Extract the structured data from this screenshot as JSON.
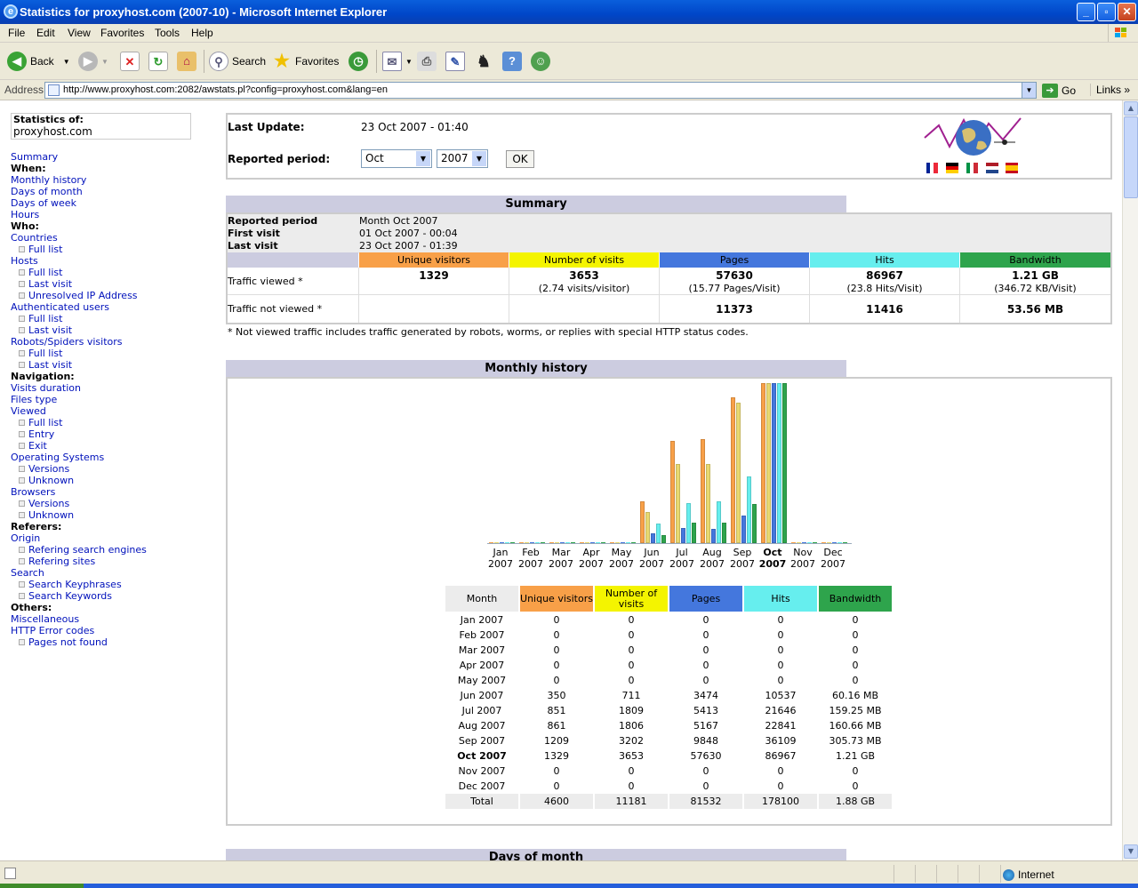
{
  "window": {
    "title": "Statistics for proxyhost.com (2007-10) - Microsoft Internet Explorer",
    "min": "_",
    "max": "▫",
    "close": "✕"
  },
  "menubar": [
    "File",
    "Edit",
    "View",
    "Favorites",
    "Tools",
    "Help"
  ],
  "toolbar": {
    "back": "Back",
    "search": "Search",
    "favorites": "Favorites"
  },
  "address": {
    "label": "Address",
    "url": "http://www.proxyhost.com:2082/awstats.pl?config=proxyhost.com&lang=en",
    "go": "Go",
    "links": "Links"
  },
  "status": {
    "zone": "Internet"
  },
  "sidebar": {
    "stats_of": "Statistics of:",
    "host": "proxyhost.com",
    "items": [
      {
        "t": "Summary",
        "k": "link",
        "lvl": 0
      },
      {
        "t": "When:",
        "k": "head",
        "lvl": 0
      },
      {
        "t": "Monthly history",
        "k": "link",
        "lvl": 0
      },
      {
        "t": "Days of month",
        "k": "link",
        "lvl": 0
      },
      {
        "t": "Days of week",
        "k": "link",
        "lvl": 0
      },
      {
        "t": "Hours",
        "k": "link",
        "lvl": 0
      },
      {
        "t": "Who:",
        "k": "head",
        "lvl": 0
      },
      {
        "t": "Countries",
        "k": "link",
        "lvl": 0
      },
      {
        "t": "Full list",
        "k": "link",
        "lvl": 1
      },
      {
        "t": "Hosts",
        "k": "link",
        "lvl": 0
      },
      {
        "t": "Full list",
        "k": "link",
        "lvl": 1
      },
      {
        "t": "Last visit",
        "k": "link",
        "lvl": 1
      },
      {
        "t": "Unresolved IP Address",
        "k": "link",
        "lvl": 1
      },
      {
        "t": "Authenticated users",
        "k": "link",
        "lvl": 0
      },
      {
        "t": "Full list",
        "k": "link",
        "lvl": 1
      },
      {
        "t": "Last visit",
        "k": "link",
        "lvl": 1
      },
      {
        "t": "Robots/Spiders visitors",
        "k": "link",
        "lvl": 0
      },
      {
        "t": "Full list",
        "k": "link",
        "lvl": 1
      },
      {
        "t": "Last visit",
        "k": "link",
        "lvl": 1
      },
      {
        "t": "Navigation:",
        "k": "head",
        "lvl": 0
      },
      {
        "t": "Visits duration",
        "k": "link",
        "lvl": 0
      },
      {
        "t": "Files type",
        "k": "link",
        "lvl": 0
      },
      {
        "t": "Viewed",
        "k": "link",
        "lvl": 0
      },
      {
        "t": "Full list",
        "k": "link",
        "lvl": 1
      },
      {
        "t": "Entry",
        "k": "link",
        "lvl": 1
      },
      {
        "t": "Exit",
        "k": "link",
        "lvl": 1
      },
      {
        "t": "Operating Systems",
        "k": "link",
        "lvl": 0
      },
      {
        "t": "Versions",
        "k": "link",
        "lvl": 1
      },
      {
        "t": "Unknown",
        "k": "link",
        "lvl": 1
      },
      {
        "t": "Browsers",
        "k": "link",
        "lvl": 0
      },
      {
        "t": "Versions",
        "k": "link",
        "lvl": 1
      },
      {
        "t": "Unknown",
        "k": "link",
        "lvl": 1
      },
      {
        "t": "Referers:",
        "k": "head",
        "lvl": 0
      },
      {
        "t": "Origin",
        "k": "link",
        "lvl": 0
      },
      {
        "t": "Refering search engines",
        "k": "link",
        "lvl": 1
      },
      {
        "t": "Refering sites",
        "k": "link",
        "lvl": 1
      },
      {
        "t": "Search",
        "k": "link",
        "lvl": 0
      },
      {
        "t": "Search Keyphrases",
        "k": "link",
        "lvl": 1
      },
      {
        "t": "Search Keywords",
        "k": "link",
        "lvl": 1
      },
      {
        "t": "Others:",
        "k": "head",
        "lvl": 0
      },
      {
        "t": "Miscellaneous",
        "k": "link",
        "lvl": 0
      },
      {
        "t": "HTTP Error codes",
        "k": "link",
        "lvl": 0
      },
      {
        "t": "Pages not found",
        "k": "link",
        "lvl": 1
      }
    ]
  },
  "header": {
    "last_update_label": "Last Update:",
    "last_update": "23 Oct 2007 - 01:40",
    "period_label": "Reported period:",
    "month": "Oct",
    "year": "2007",
    "ok": "OK"
  },
  "summary": {
    "title": "Summary",
    "reported_period_label": "Reported period",
    "reported_period": "Month Oct 2007",
    "first_visit_label": "First visit",
    "first_visit": "01 Oct 2007 - 00:04",
    "last_visit_label": "Last visit",
    "last_visit": "23 Oct 2007 - 01:39",
    "cols": [
      "Unique visitors",
      "Number of visits",
      "Pages",
      "Hits",
      "Bandwidth"
    ],
    "viewed_label": "Traffic viewed *",
    "viewed": [
      {
        "v": "1329",
        "s": ""
      },
      {
        "v": "3653",
        "s": "(2.74 visits/visitor)"
      },
      {
        "v": "57630",
        "s": "(15.77 Pages/Visit)"
      },
      {
        "v": "86967",
        "s": "(23.8 Hits/Visit)"
      },
      {
        "v": "1.21 GB",
        "s": "(346.72 KB/Visit)"
      }
    ],
    "notviewed_label": "Traffic not viewed *",
    "notviewed": [
      "",
      "",
      "11373",
      "11416",
      "53.56 MB"
    ],
    "note": "* Not viewed traffic includes traffic generated by robots, worms, or replies with special HTTP status codes."
  },
  "monthly": {
    "title": "Monthly history",
    "cols": [
      "Month",
      "Unique visitors",
      "Number of visits",
      "Pages",
      "Hits",
      "Bandwidth"
    ],
    "rows": [
      [
        "Jan 2007",
        "0",
        "0",
        "0",
        "0",
        "0"
      ],
      [
        "Feb 2007",
        "0",
        "0",
        "0",
        "0",
        "0"
      ],
      [
        "Mar 2007",
        "0",
        "0",
        "0",
        "0",
        "0"
      ],
      [
        "Apr 2007",
        "0",
        "0",
        "0",
        "0",
        "0"
      ],
      [
        "May 2007",
        "0",
        "0",
        "0",
        "0",
        "0"
      ],
      [
        "Jun 2007",
        "350",
        "711",
        "3474",
        "10537",
        "60.16 MB"
      ],
      [
        "Jul 2007",
        "851",
        "1809",
        "5413",
        "21646",
        "159.25 MB"
      ],
      [
        "Aug 2007",
        "861",
        "1806",
        "5167",
        "22841",
        "160.66 MB"
      ],
      [
        "Sep 2007",
        "1209",
        "3202",
        "9848",
        "36109",
        "305.73 MB"
      ],
      [
        "Oct 2007",
        "1329",
        "3653",
        "57630",
        "86967",
        "1.21 GB"
      ],
      [
        "Nov 2007",
        "0",
        "0",
        "0",
        "0",
        "0"
      ],
      [
        "Dec 2007",
        "0",
        "0",
        "0",
        "0",
        "0"
      ]
    ],
    "total": [
      "Total",
      "4600",
      "11181",
      "81532",
      "178100",
      "1.88 GB"
    ]
  },
  "chart_data": {
    "type": "bar",
    "categories": [
      "Jan",
      "Feb",
      "Mar",
      "Apr",
      "May",
      "Jun",
      "Jul",
      "Aug",
      "Sep",
      "Oct",
      "Nov",
      "Dec"
    ],
    "year_labels": [
      "2007",
      "2007",
      "2007",
      "2007",
      "2007",
      "2007",
      "2007",
      "2007",
      "2007",
      "2007",
      "2007",
      "2007"
    ],
    "highlight": "Oct",
    "series": [
      {
        "name": "Unique visitors",
        "color": "#f8a048",
        "values": [
          0,
          0,
          0,
          0,
          0,
          350,
          851,
          861,
          1209,
          1329,
          0,
          0
        ]
      },
      {
        "name": "Number of visits",
        "color": "#e8d870",
        "values": [
          0,
          0,
          0,
          0,
          0,
          711,
          1809,
          1806,
          3202,
          3653,
          0,
          0
        ]
      },
      {
        "name": "Pages",
        "color": "#4477dd",
        "values": [
          0,
          0,
          0,
          0,
          0,
          3474,
          5413,
          5167,
          9848,
          57630,
          0,
          0
        ]
      },
      {
        "name": "Hits",
        "color": "#66eeee",
        "values": [
          0,
          0,
          0,
          0,
          0,
          10537,
          21646,
          22841,
          36109,
          86967,
          0,
          0
        ]
      },
      {
        "name": "Bandwidth (MB)",
        "color": "#2ea44c",
        "values": [
          0,
          0,
          0,
          0,
          0,
          60.16,
          159.25,
          160.66,
          305.73,
          1239,
          0,
          0
        ]
      }
    ]
  },
  "next_section": {
    "title": "Days of month"
  },
  "colors": {
    "visitors": "#f8a048",
    "visits": "#f4f400",
    "pages": "#4477dd",
    "hits": "#66eeee",
    "bandwidth": "#2ea44c",
    "thead": "#cccce0"
  }
}
